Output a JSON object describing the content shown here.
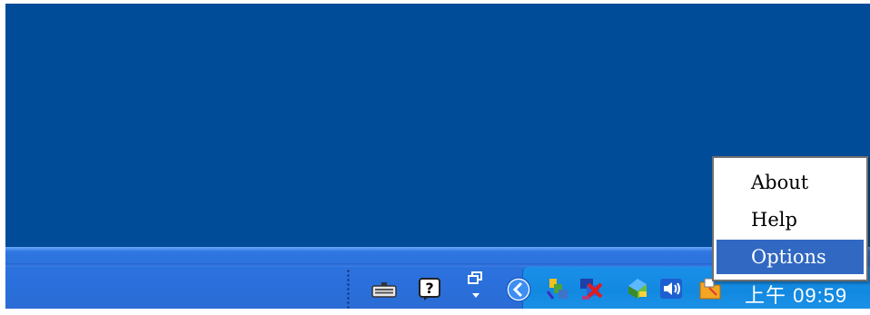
{
  "context_menu": {
    "items": [
      {
        "label": "About",
        "selected": false
      },
      {
        "label": "Help",
        "selected": false
      },
      {
        "label": "Options",
        "selected": true
      }
    ]
  },
  "system_tray": {
    "clock_text": "上午 09:59",
    "icons": [
      "keyboard-icon",
      "help-icon",
      "restore-window-icon",
      "show-hidden-icons-chevron",
      "network-icon",
      "security-alert-icon",
      "tray-app-icon",
      "volume-icon",
      "folder-app-icon"
    ]
  },
  "colors": {
    "desktop": "#004c98",
    "taskbar": "#2a6fdb",
    "tray": "#1289e0",
    "menu_highlight": "#3168c2"
  }
}
